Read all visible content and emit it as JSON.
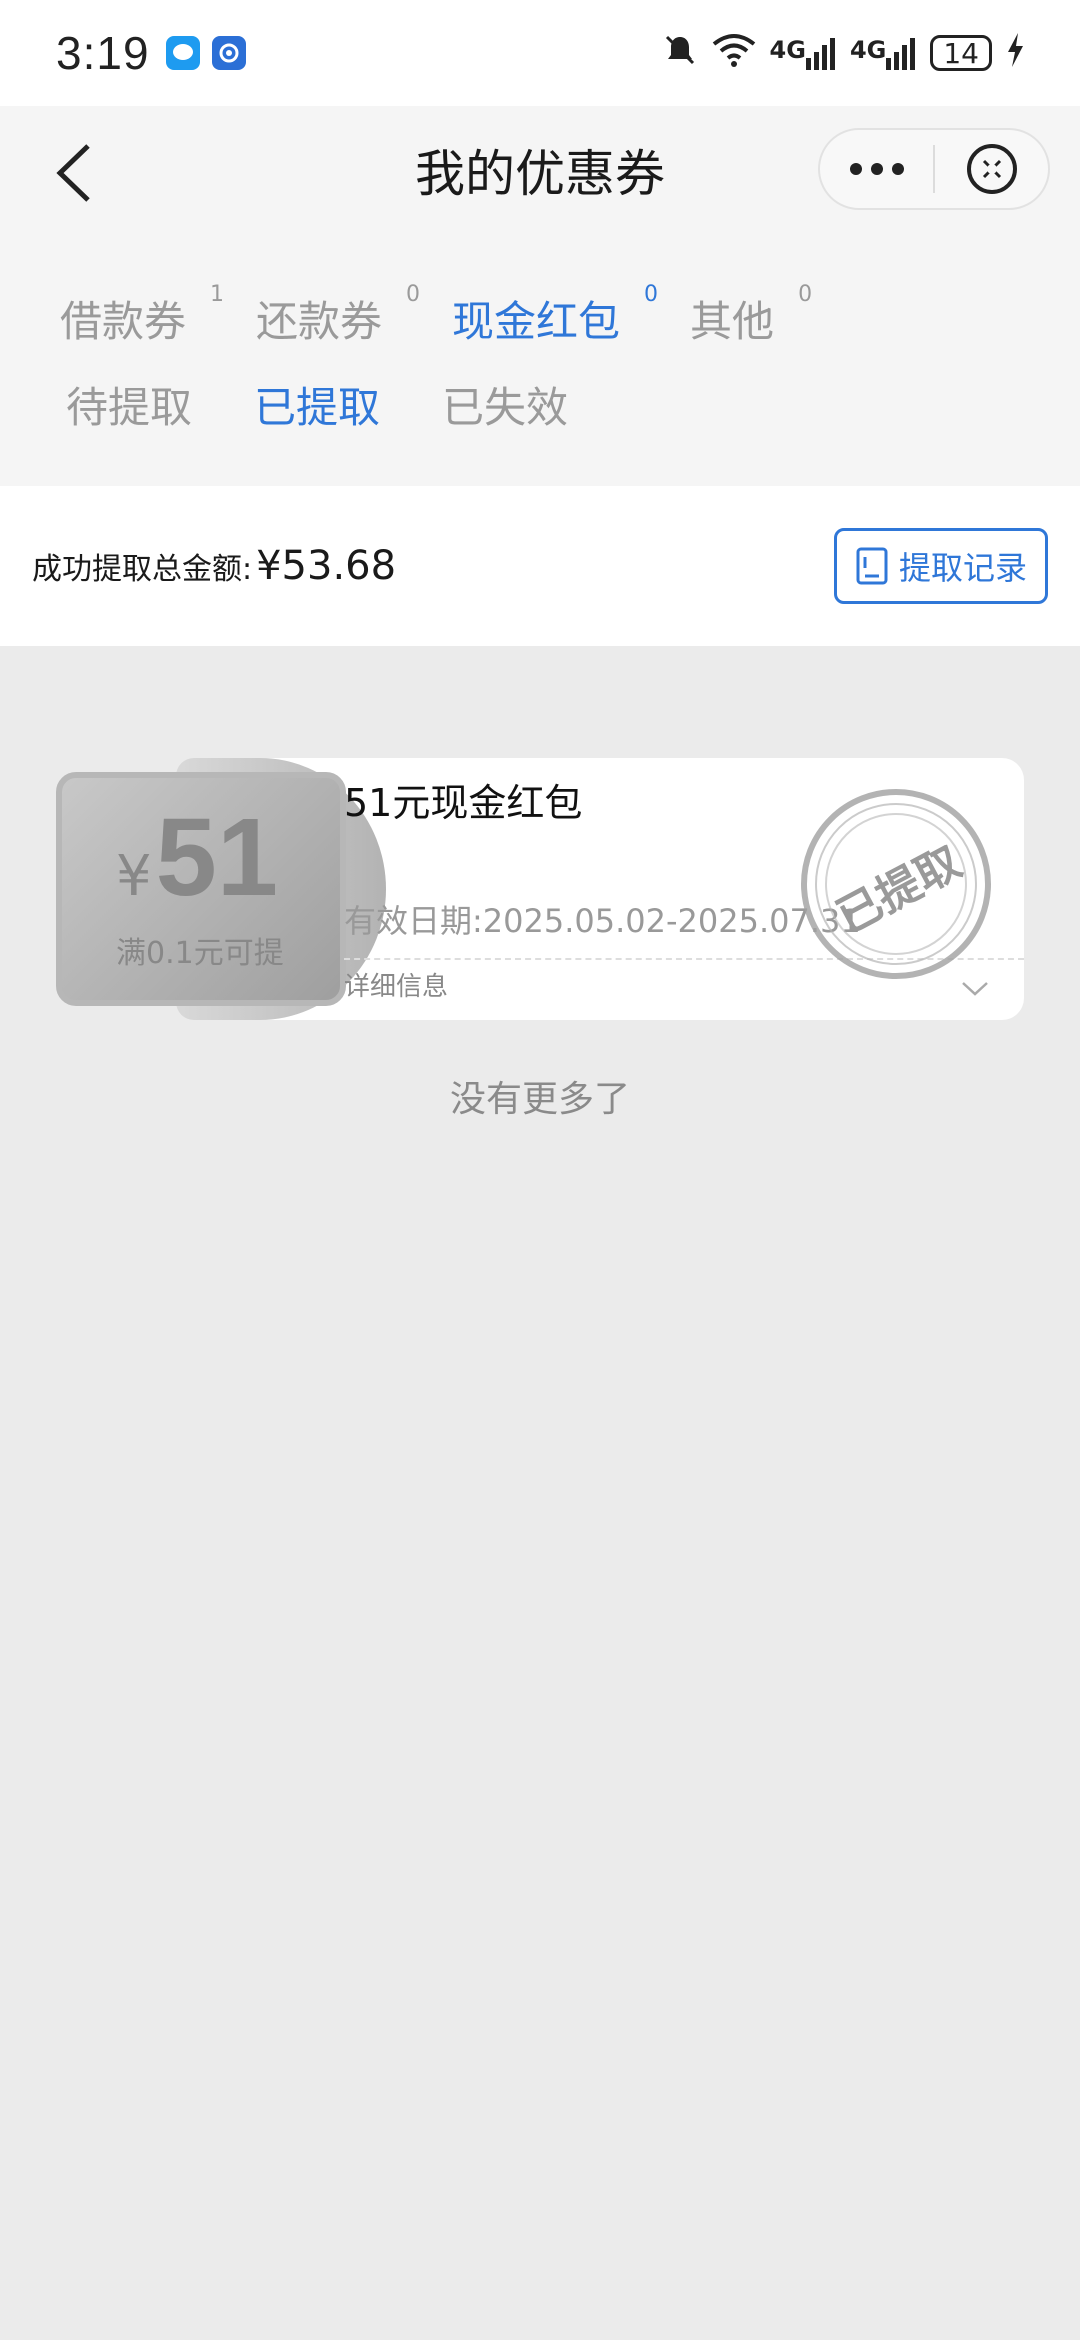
{
  "status_bar": {
    "time": "3:19",
    "battery_level": "14",
    "signal_1": "4G",
    "signal_2": "4G",
    "icons": [
      "message-app-icon",
      "browser-app-icon",
      "mute-icon",
      "wifi-icon",
      "signal-icon",
      "charging-icon"
    ]
  },
  "nav": {
    "title": "我的优惠券",
    "back_icon": "back-arrow-icon",
    "more_icon": "more-icon",
    "close_icon": "close-icon"
  },
  "type_tabs": [
    {
      "label": "借款券",
      "count": "1",
      "active": false
    },
    {
      "label": "还款券",
      "count": "0",
      "active": false
    },
    {
      "label": "现金红包",
      "count": "0",
      "active": true
    },
    {
      "label": "其他",
      "count": "0",
      "active": false
    }
  ],
  "status_tabs": [
    {
      "label": "待提取",
      "active": false
    },
    {
      "label": "已提取",
      "active": true
    },
    {
      "label": "已失效",
      "active": false
    }
  ],
  "summary": {
    "label": "成功提取总金额:",
    "amount": "¥53.68",
    "record_button": "提取记录"
  },
  "coupon": {
    "yen": "¥",
    "value": "51",
    "condition": "满0.1元可提",
    "title": "51元现金红包",
    "valid": "有效日期:2025.05.02-2025.07.31",
    "detail": "详细信息",
    "stamp": "已提取"
  },
  "footer": {
    "no_more": "没有更多了"
  },
  "colors": {
    "accent": "#2f77d8",
    "inactive": "#9a9a9a",
    "page_bg": "#ebebeb"
  }
}
